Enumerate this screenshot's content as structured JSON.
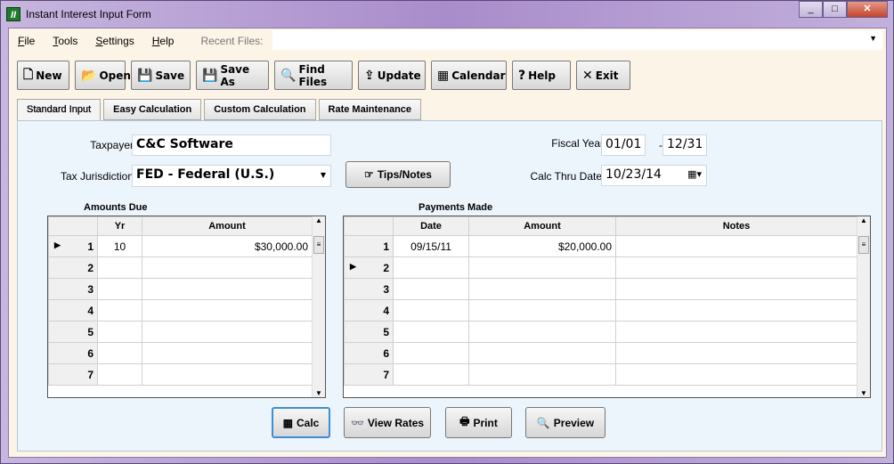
{
  "window": {
    "title": "Instant Interest Input Form",
    "app_icon": "II",
    "controls": [
      "minimize",
      "maximize",
      "close"
    ]
  },
  "menu": {
    "items": [
      "File",
      "Tools",
      "Settings",
      "Help"
    ],
    "recent_label": "Recent Files:",
    "recent_value": ""
  },
  "toolbar": [
    {
      "label": "New",
      "icon": "new-file-icon",
      "glyph": "🗋"
    },
    {
      "label": "Open",
      "icon": "open-folder-icon",
      "glyph": "📂"
    },
    {
      "label": "Save",
      "icon": "save-icon",
      "glyph": "💾"
    },
    {
      "label": "Save As",
      "icon": "save-as-icon",
      "glyph": "💾"
    },
    {
      "label": "Find Files",
      "icon": "binoculars-icon",
      "glyph": "🔍"
    },
    {
      "label": "Update",
      "icon": "update-icon",
      "glyph": "⇪"
    },
    {
      "label": "Calendar",
      "icon": "calendar-icon",
      "glyph": "▦"
    },
    {
      "label": "Help",
      "icon": "help-icon",
      "glyph": "?"
    },
    {
      "label": "Exit",
      "icon": "exit-icon",
      "glyph": "✕"
    }
  ],
  "tabs": [
    "Standard Input",
    "Easy Calculation",
    "Custom Calculation",
    "Rate Maintenance"
  ],
  "form": {
    "taxpayer_label": "Taxpayer",
    "taxpayer": "C&C Software",
    "jurisdiction_label": "Tax Jurisdiction",
    "jurisdiction": "FED - Federal (U.S.)",
    "tips_label": "Tips/Notes",
    "fiscal_year_label": "Fiscal Year",
    "fy_start": "01/01",
    "fy_sep": "-",
    "fy_end": "12/31",
    "calc_thru_label": "Calc Thru Date",
    "calc_thru": "10/23/14"
  },
  "amounts_due": {
    "title": "Amounts Due",
    "columns": [
      "",
      "Yr",
      "Amount"
    ],
    "rows": [
      [
        "1",
        "10",
        "$30,000.00"
      ],
      [
        "2",
        "",
        ""
      ],
      [
        "3",
        "",
        ""
      ],
      [
        "4",
        "",
        ""
      ],
      [
        "5",
        "",
        ""
      ],
      [
        "6",
        "",
        ""
      ],
      [
        "7",
        "",
        ""
      ]
    ],
    "current_row": 1
  },
  "payments_made": {
    "title": "Payments Made",
    "columns": [
      "",
      "Date",
      "Amount",
      "Notes"
    ],
    "rows": [
      [
        "1",
        "09/15/11",
        "$20,000.00",
        ""
      ],
      [
        "2",
        "",
        "",
        ""
      ],
      [
        "3",
        "",
        "",
        ""
      ],
      [
        "4",
        "",
        "",
        ""
      ],
      [
        "5",
        "",
        "",
        ""
      ],
      [
        "6",
        "",
        "",
        ""
      ],
      [
        "7",
        "",
        "",
        ""
      ]
    ],
    "current_row": 2
  },
  "bottom_buttons": [
    {
      "label": "Calc",
      "icon": "calculator-icon",
      "glyph": "▦"
    },
    {
      "label": "View Rates",
      "icon": "glasses-icon",
      "glyph": "👓"
    },
    {
      "label": "Print",
      "icon": "printer-icon",
      "glyph": "🖶"
    },
    {
      "label": "Preview",
      "icon": "preview-icon",
      "glyph": "🔍"
    }
  ]
}
